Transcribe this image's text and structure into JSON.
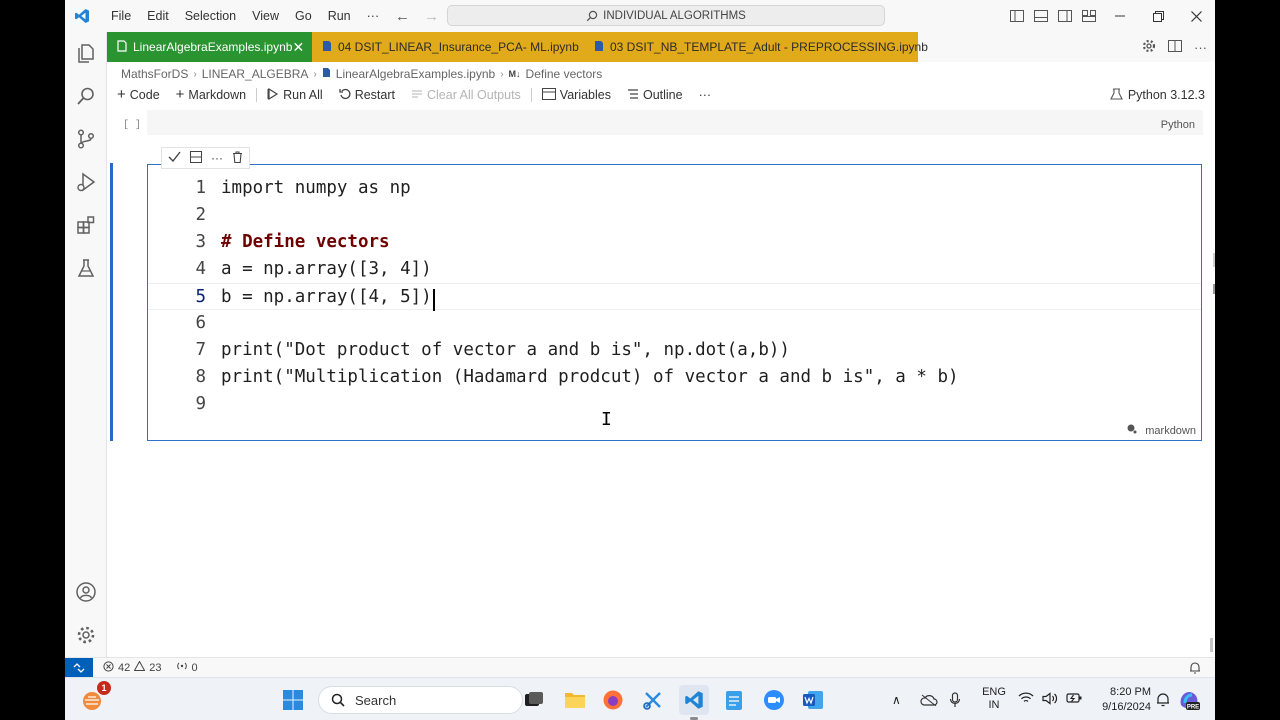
{
  "menu": [
    "File",
    "Edit",
    "Selection",
    "View",
    "Go",
    "Run",
    "···"
  ],
  "search": {
    "text": "INDIVIDUAL ALGORITHMS"
  },
  "tabs": [
    {
      "label": "LinearAlgebraExamples.ipynb",
      "active": true,
      "color": "#2a9430"
    },
    {
      "label": "04 DSIT_LINEAR_Insurance_PCA- ML.ipynb",
      "color": "#e0aa1a"
    },
    {
      "label": "03 DSIT_NB_TEMPLATE_Adult - PREPROCESSING.ipynb",
      "color": "#e0aa1a"
    }
  ],
  "breadcrumb": [
    "MathsForDS",
    "LINEAR_ALGEBRA",
    "LinearAlgebraExamples.ipynb",
    "Define vectors"
  ],
  "breadcrumb_md_icon": "M↓",
  "toolbar": {
    "code": "Code",
    "markdown": "Markdown",
    "run_all": "Run All",
    "restart": "Restart",
    "clear_outputs": "Clear All Outputs",
    "variables": "Variables",
    "outline": "Outline",
    "more": "···",
    "kernel": "Python 3.12.3"
  },
  "cell1": {
    "bracket": "[ ]",
    "language": "Python"
  },
  "cell2": {
    "language": "markdown",
    "lines": [
      {
        "n": "1",
        "text": "import numpy as np"
      },
      {
        "n": "2",
        "text": ""
      },
      {
        "n": "3",
        "text": "# Define vectors",
        "comment": true
      },
      {
        "n": "4",
        "text": "a = np.array([3, 4])"
      },
      {
        "n": "5",
        "text": "b = np.array([4, 5])",
        "current": true
      },
      {
        "n": "6",
        "text": ""
      },
      {
        "n": "7",
        "text": "print(\"Dot product of vector a and b is\", np.dot(a,b))"
      },
      {
        "n": "8",
        "text": "print(\"Multiplication (Hadamard prodcut) of vector a and b is\", a * b)"
      },
      {
        "n": "9",
        "text": ""
      }
    ],
    "tools_more": "···"
  },
  "status": {
    "errors": "42",
    "warnings": "23",
    "ports": "0"
  },
  "taskbar": {
    "search_placeholder": "Search",
    "notification_count": "1",
    "lang_top": "ENG",
    "lang_bottom": "IN",
    "time": "8:20 PM",
    "date": "9/16/2024"
  },
  "colors": {
    "accent": "#2b72c8",
    "active_tab": "#2a9430",
    "other_tabs": "#e0aa1a",
    "comment": "#6e0000",
    "remote": "#005fb8"
  }
}
